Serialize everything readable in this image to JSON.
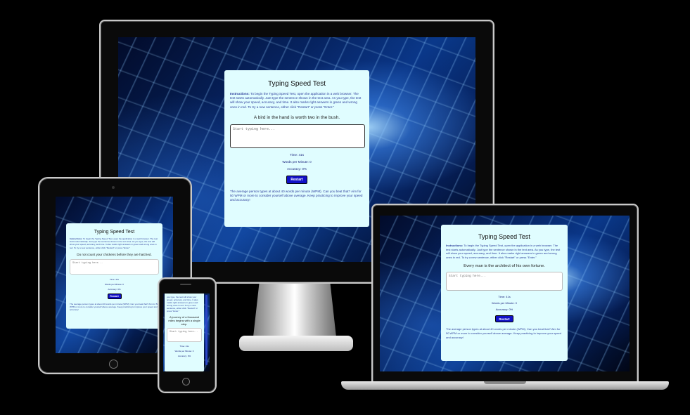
{
  "app": {
    "title": "Typing Speed Test",
    "instructions_label": "Instructions:",
    "instructions_text": " To begin the Typing Speed Test, open the application in a web browser. The test starts automatically. Just type the sentence shown in the text area. As you type, the test will show your speed, accuracy, and time. It also marks right answers in green and wrong ones in red. To try a new sentence, either click \"Restart\" or press \"Enter.\"",
    "placeholder": "Start typing here...",
    "time": "Time: 41s",
    "wpm": "Words per Minute: 0",
    "accuracy": "Accuracy: 0%",
    "restart_label": "Restart",
    "footer": "The average person types at about 40 words per minute (WPM). Can you beat that? Aim for 50 WPM or more to consider yourself above average. Keep practicing to improve your speed and accuracy!"
  },
  "devices": {
    "monitor": {
      "sentence": "A bird in the hand is worth two in the bush."
    },
    "laptop": {
      "sentence": "Every man is the architect of his own fortune."
    },
    "tablet": {
      "sentence": "Do not count your chickens before they are hatched."
    },
    "phone": {
      "sentence": "A journey of a thousand miles begins with a single step.",
      "instructions_tail": "you type, the test will show your speed, accuracy, and time. It also marks right answers in green and wrong ones in red. To try a new sentence, either click \"Restart\" or press \"Enter.\""
    }
  }
}
